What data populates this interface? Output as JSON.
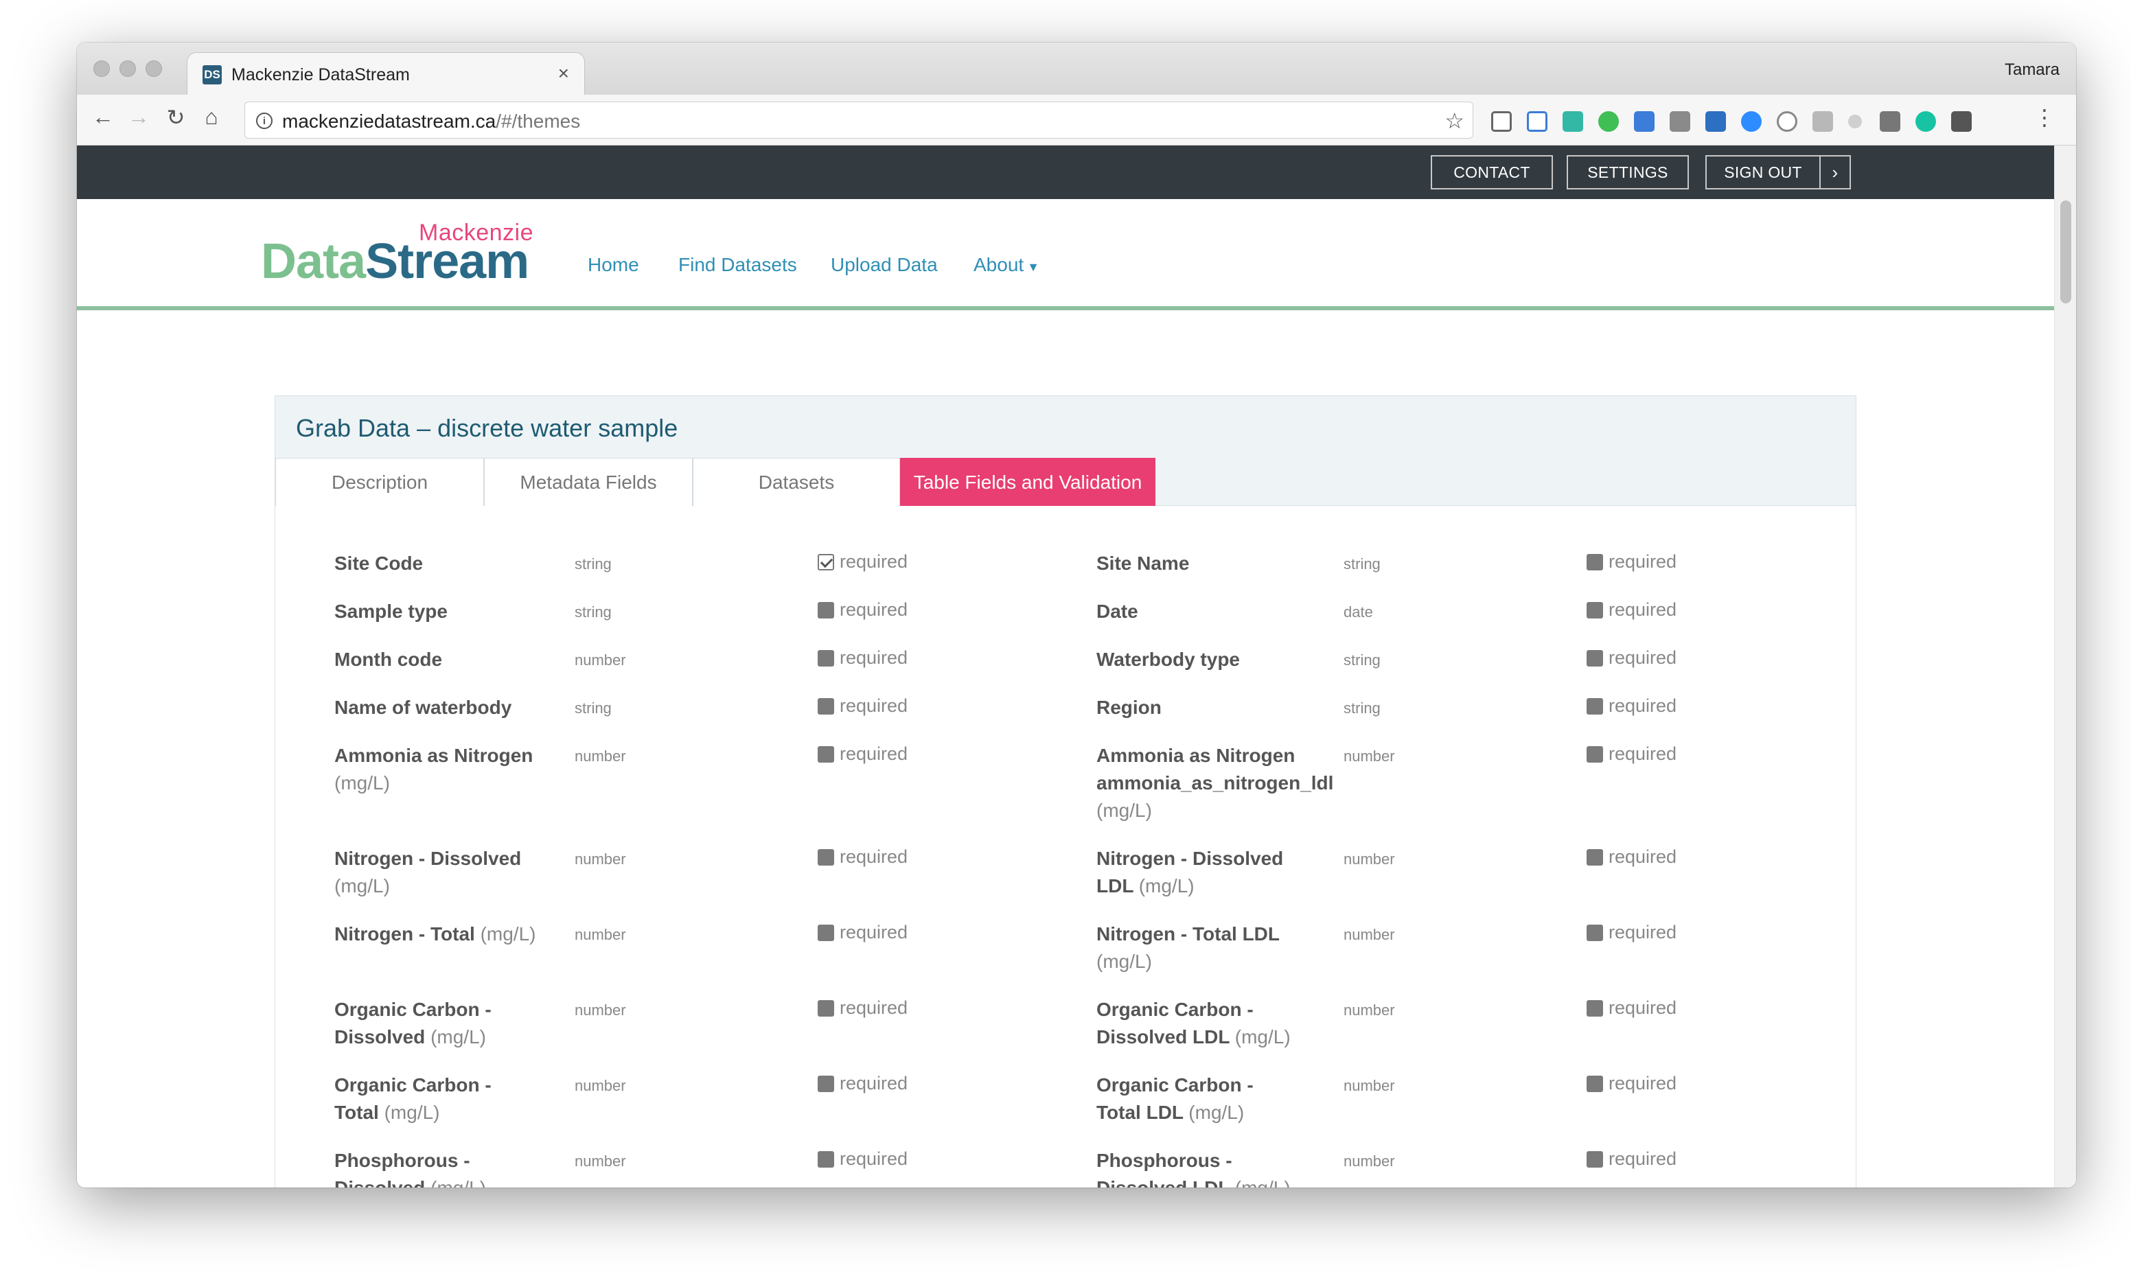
{
  "browser": {
    "tab_title": "Mackenzie DataStream",
    "tab_favicon": "DS",
    "tab_close": "×",
    "profile_name": "Tamara",
    "url_host": "mackenziedatastream.ca",
    "url_path": "/#/themes"
  },
  "topbar": {
    "contact": "CONTACT",
    "settings": "SETTINGS",
    "sign_out": "SIGN OUT"
  },
  "logo": {
    "small": "Mackenzie",
    "data": "Data",
    "stream": "Stream"
  },
  "nav": {
    "home": "Home",
    "find": "Find Datasets",
    "upload": "Upload Data",
    "about": "About"
  },
  "card": {
    "title": "Grab Data – discrete water sample",
    "tabs": [
      "Description",
      "Metadata Fields",
      "Datasets",
      "Table Fields and Validation"
    ],
    "active_tab": "Table Fields and Validation"
  },
  "required_label": "required",
  "fields_left": [
    {
      "name": "Site Code",
      "unit": "",
      "type": "string",
      "checked": true
    },
    {
      "name": "Sample type",
      "unit": "",
      "type": "string",
      "checked": false
    },
    {
      "name": "Month code",
      "unit": "",
      "type": "number",
      "checked": false
    },
    {
      "name": "Name of waterbody",
      "unit": "",
      "type": "string",
      "checked": false
    },
    {
      "name": "Ammonia as Nitrogen",
      "unit": "(mg/L)",
      "type": "number",
      "checked": false
    },
    {
      "name": "Nitrogen - Dissolved",
      "unit": "(mg/L)",
      "type": "number",
      "checked": false
    },
    {
      "name": "Nitrogen - Total",
      "unit": "(mg/L)",
      "type": "number",
      "checked": false
    },
    {
      "name": "Organic Carbon - Dissolved",
      "unit": "(mg/L)",
      "type": "number",
      "checked": false
    },
    {
      "name": "Organic Carbon - Total",
      "unit": "(mg/L)",
      "type": "number",
      "checked": false
    },
    {
      "name": "Phosphorous - Dissolved",
      "unit": "(mg/L)",
      "type": "number",
      "checked": false
    }
  ],
  "fields_right": [
    {
      "name": "Site Name",
      "unit": "",
      "type": "string",
      "checked": false
    },
    {
      "name": "Date",
      "unit": "",
      "type": "date",
      "checked": false
    },
    {
      "name": "Waterbody type",
      "unit": "",
      "type": "string",
      "checked": false
    },
    {
      "name": "Region",
      "unit": "",
      "type": "string",
      "checked": false
    },
    {
      "name": "Ammonia as Nitrogen ammonia_as_nitrogen_ldl",
      "unit": "(mg/L)",
      "type": "number",
      "checked": false
    },
    {
      "name": "Nitrogen - Dissolved LDL",
      "unit": "(mg/L)",
      "type": "number",
      "checked": false
    },
    {
      "name": "Nitrogen - Total LDL",
      "unit": "(mg/L)",
      "type": "number",
      "checked": false
    },
    {
      "name": "Organic Carbon - Dissolved LDL",
      "unit": "(mg/L)",
      "type": "number",
      "checked": false
    },
    {
      "name": "Organic Carbon - Total LDL",
      "unit": "(mg/L)",
      "type": "number",
      "checked": false
    },
    {
      "name": "Phosphorous - Dissolved LDL",
      "unit": "(mg/L)",
      "type": "number",
      "checked": false
    }
  ]
}
